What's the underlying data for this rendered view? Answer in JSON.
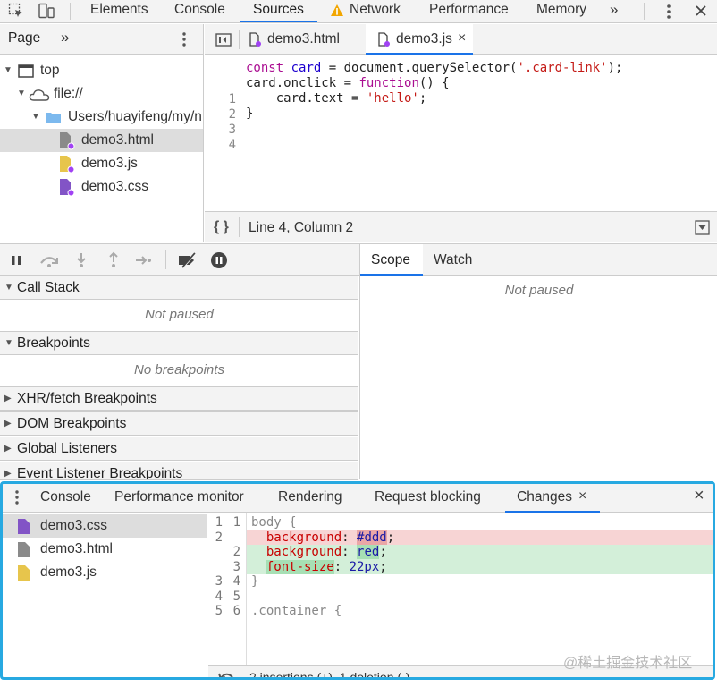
{
  "topbar": {
    "tabs": [
      "Elements",
      "Console",
      "Sources",
      "Network",
      "Performance",
      "Memory"
    ],
    "active": "Sources",
    "more": "»"
  },
  "navigator": {
    "tab": "Page",
    "more": "»",
    "tree": [
      {
        "label": "top",
        "icon": "frame-icon"
      },
      {
        "label": "file://",
        "icon": "cloud-icon"
      },
      {
        "label": "Users/huayifeng/my/n",
        "icon": "folder-icon"
      },
      {
        "label": "demo3.html",
        "icon": "html-file-icon",
        "selected": true
      },
      {
        "label": "demo3.js",
        "icon": "js-file-icon"
      },
      {
        "label": "demo3.css",
        "icon": "css-file-icon"
      }
    ]
  },
  "editor": {
    "tabs": [
      {
        "label": "demo3.html",
        "active": false
      },
      {
        "label": "demo3.js",
        "active": true,
        "close": "×"
      }
    ],
    "lines": [
      "1",
      "2",
      "3",
      "4"
    ],
    "status": {
      "format": "{ }",
      "position": "Line 4, Column 2"
    }
  },
  "debugger": {
    "sections": [
      {
        "label": "Call Stack",
        "expanded": true,
        "placeholder": "Not paused"
      },
      {
        "label": "Breakpoints",
        "expanded": true,
        "placeholder": "No breakpoints"
      },
      {
        "label": "XHR/fetch Breakpoints",
        "expanded": false
      },
      {
        "label": "DOM Breakpoints",
        "expanded": false
      },
      {
        "label": "Global Listeners",
        "expanded": false
      },
      {
        "label": "Event Listener Breakpoints",
        "expanded": false
      }
    ],
    "scope_tabs": [
      "Scope",
      "Watch"
    ],
    "scope_placeholder": "Not paused"
  },
  "drawer": {
    "tabs": [
      "Console",
      "Performance monitor",
      "Rendering",
      "Request blocking",
      "Changes"
    ],
    "active": "Changes",
    "close_tab": "×",
    "close_drawer": "×",
    "files": [
      {
        "label": "demo3.css",
        "icon": "css-file-icon",
        "selected": true
      },
      {
        "label": "demo3.html",
        "icon": "html-file-icon"
      },
      {
        "label": "demo3.js",
        "icon": "js-file-icon"
      }
    ],
    "diff_numbers": {
      "l1": [
        "1",
        "1"
      ],
      "l2": [
        "2",
        ""
      ],
      "l3": [
        "",
        "2"
      ],
      "l4": [
        "",
        "3"
      ],
      "l5": [
        "3",
        "4"
      ],
      "l6": [
        "4",
        "5"
      ],
      "l7": [
        "5",
        "6"
      ]
    },
    "summary": "2 insertions (+), 1 deletion (-)"
  },
  "watermark": "@稀土掘金技术社区",
  "colors": {
    "accent": "#1a73e8",
    "drawer_border": "#27a9e1",
    "deleted": "#f7d4d4",
    "added": "#d3efd9"
  }
}
